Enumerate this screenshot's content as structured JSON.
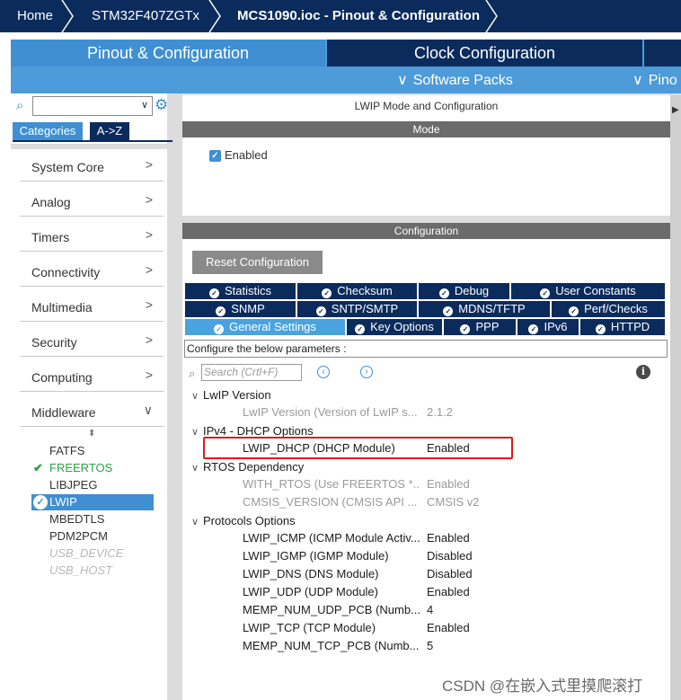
{
  "breadcrumbs": [
    "Home",
    "STM32F407ZGTx",
    "MCS1090.ioc - Pinout & Configuration"
  ],
  "main_tabs": {
    "pinout": "Pinout & Configuration",
    "clock": "Clock Configuration"
  },
  "sub_tabs": {
    "software_packs": "Software Packs",
    "pinout": "Pino"
  },
  "left": {
    "category_tab": "Categories",
    "az_tab": "A->Z",
    "categories": [
      "System Core",
      "Analog",
      "Timers",
      "Connectivity",
      "Multimedia",
      "Security",
      "Computing",
      "Middleware"
    ],
    "middleware_items": [
      "FATFS",
      "FREERTOS",
      "LIBJPEG",
      "LWIP",
      "MBEDTLS",
      "PDM2PCM",
      "USB_DEVICE",
      "USB_HOST"
    ]
  },
  "mode": {
    "title": "LWIP Mode and Configuration",
    "bar": "Mode",
    "enabled_label": "Enabled"
  },
  "config": {
    "bar": "Configuration",
    "reset_button": "Reset Configuration",
    "tabs_row1": [
      "Statistics",
      "Checksum",
      "Debug",
      "User Constants"
    ],
    "tabs_row2": [
      "SNMP",
      "SNTP/SMTP",
      "MDNS/TFTP",
      "Perf/Checks"
    ],
    "tabs_row3": [
      "General Settings",
      "Key Options",
      "PPP",
      "IPv6",
      "HTTPD"
    ],
    "hint": "Configure the below parameters :",
    "search_placeholder": "Search (Crtl+F)",
    "groups": {
      "lwip_version": "LwIP Version",
      "ipv4_dhcp": "IPv4 - DHCP Options",
      "rtos": "RTOS Dependency",
      "protocols": "Protocols Options"
    },
    "rows": {
      "lwip_version": {
        "name": "LwIP Version (Version of LwIP s...",
        "value": "2.1.2"
      },
      "lwip_dhcp": {
        "name": "LWIP_DHCP (DHCP Module)",
        "value": "Enabled"
      },
      "with_rtos": {
        "name": "WITH_RTOS (Use FREERTOS *...",
        "value": "Enabled"
      },
      "cmsis_version": {
        "name": "CMSIS_VERSION (CMSIS API ...",
        "value": "CMSIS v2"
      },
      "icmp": {
        "name": "LWIP_ICMP (ICMP Module Activ...",
        "value": "Enabled"
      },
      "igmp": {
        "name": "LWIP_IGMP (IGMP Module)",
        "value": "Disabled"
      },
      "dns": {
        "name": "LWIP_DNS (DNS Module)",
        "value": "Disabled"
      },
      "udp": {
        "name": "LWIP_UDP (UDP Module)",
        "value": "Enabled"
      },
      "udp_pcb": {
        "name": "MEMP_NUM_UDP_PCB (Numb...",
        "value": "4"
      },
      "tcp": {
        "name": "LWIP_TCP (TCP Module)",
        "value": "Enabled"
      },
      "tcp_pcb": {
        "name": "MEMP_NUM_TCP_PCB (Numb...",
        "value": "5"
      }
    }
  },
  "watermark": "CSDN @在嵌入式里摸爬滚打",
  "colors": {
    "navy": "#0a2b5c",
    "blue": "#3f8fd2",
    "highlight": "#e01b1b",
    "green": "#2ea043"
  }
}
